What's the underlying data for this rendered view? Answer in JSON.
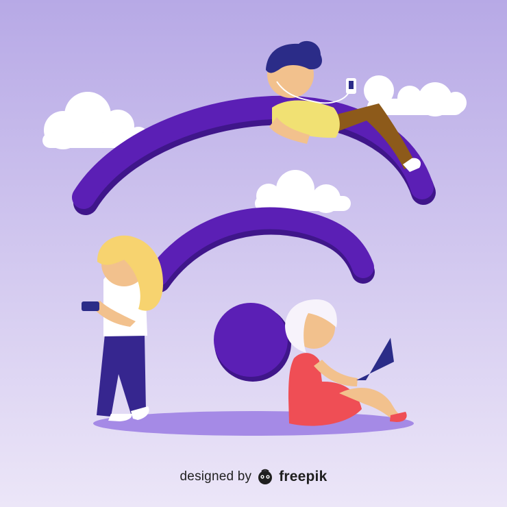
{
  "credit": {
    "prefix": "designed by",
    "brand": "freepik",
    "logo_icon": "freepik-logo-icon"
  },
  "scene": {
    "subject": "wifi-signal-with-people-using-devices",
    "colors": {
      "background_top": "#b7a9e6",
      "background_bottom": "#ece6f8",
      "wifi_purple": "#5b1fb5",
      "wifi_purple_shadow": "#3f168a",
      "ground_shadow": "#a58ae6",
      "cloud": "#ffffff",
      "skin": "#f2c18d",
      "hair_blonde": "#f7d36f",
      "hair_navy": "#2b2c88",
      "shirt_yellow": "#f1e173",
      "pants_olive": "#8d5a1a",
      "pants_indigo": "#36268f",
      "dress_red": "#ef4e55",
      "hair_white": "#f7f3fb"
    },
    "devices": [
      "music-player-icon",
      "smartphone-icon",
      "laptop-icon"
    ]
  }
}
